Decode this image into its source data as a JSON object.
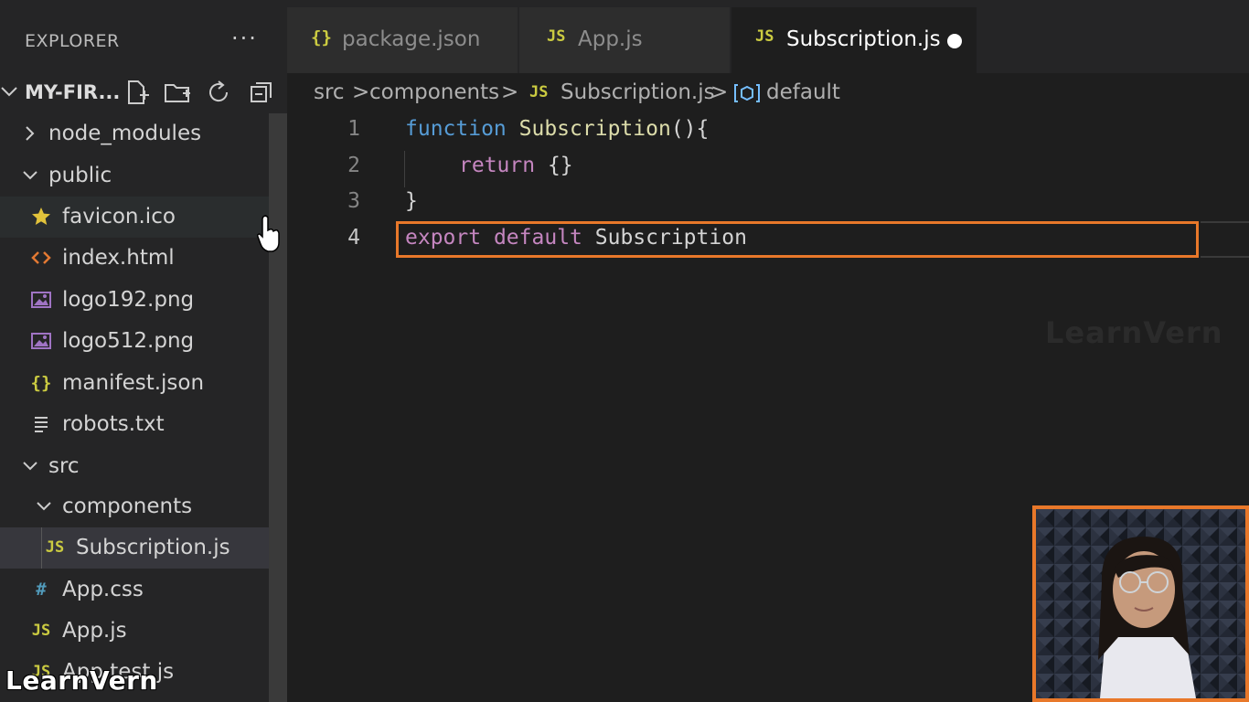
{
  "sidebar": {
    "title": "EXPLORER",
    "more": "···",
    "project": "MY-FIR...",
    "tree": [
      {
        "label": "node_modules"
      },
      {
        "label": "public"
      },
      {
        "label": "favicon.ico",
        "icon": "star-icon"
      },
      {
        "label": "index.html",
        "icon": "html-icon"
      },
      {
        "label": "logo192.png",
        "icon": "image-icon"
      },
      {
        "label": "logo512.png",
        "icon": "image-icon"
      },
      {
        "label": "manifest.json",
        "icon": "json-icon",
        "icon_text": "{}"
      },
      {
        "label": "robots.txt",
        "icon": "text-file-icon"
      },
      {
        "label": "src"
      },
      {
        "label": "components"
      },
      {
        "label": "Subscription.js",
        "icon": "js-icon",
        "icon_text": "JS"
      },
      {
        "label": "App.css",
        "icon": "css-icon",
        "icon_text": "#"
      },
      {
        "label": "App.js",
        "icon": "js-icon",
        "icon_text": "JS"
      },
      {
        "label": "App.test.js",
        "icon": "js-icon",
        "icon_text": "JS"
      }
    ]
  },
  "tabs": [
    {
      "label": "package.json",
      "icon_text": "{}"
    },
    {
      "label": "App.js",
      "icon_text": "JS"
    },
    {
      "label": "Subscription.js",
      "icon_text": "JS"
    }
  ],
  "breadcrumb": {
    "parts": [
      "src",
      "components",
      "Subscription.js",
      "default"
    ],
    "sep": ">",
    "js_icon": "JS"
  },
  "editor": {
    "line_numbers": [
      "1",
      "2",
      "3",
      "4"
    ],
    "lines": {
      "l1_kw": "function",
      "l1_name": "Subscription",
      "l1_rest": "(){",
      "l2_kw": "return",
      "l2_rest": "{}",
      "l3": "}",
      "l4_kw1": "export",
      "l4_kw2": "default",
      "l4_name": "Subscription"
    }
  },
  "watermark": "LearnVern",
  "colors": {
    "accent_highlight": "#e8782a",
    "keyword_blue": "#569cd6",
    "keyword_purple": "#c586c0",
    "function_yellow": "#dcdcaa",
    "js_icon": "#cbcb41"
  }
}
